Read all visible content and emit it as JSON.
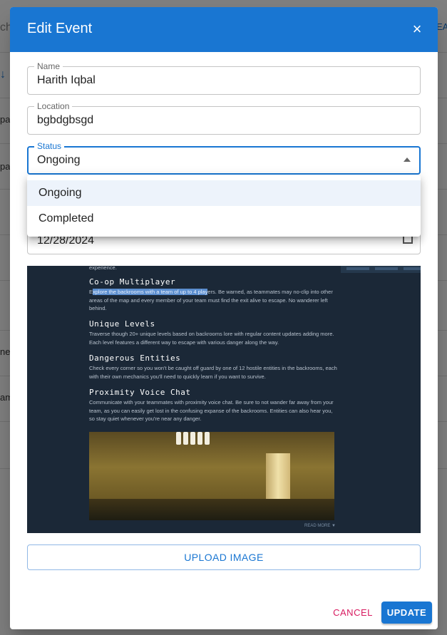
{
  "background": {
    "fragments": [
      "ch",
      "EA",
      "↓",
      "pa",
      "pa",
      "ne",
      "am"
    ]
  },
  "dialog": {
    "title": "Edit Event",
    "close_icon": "close-icon",
    "fields": {
      "name": {
        "label": "Name",
        "value": "Harith Iqbal"
      },
      "location": {
        "label": "Location",
        "value": "bgbdgbsgd"
      },
      "status": {
        "label": "Status",
        "value": "Ongoing"
      },
      "date": {
        "value": "12/28/2024"
      }
    },
    "status_menu": {
      "options": [
        "Ongoing",
        "Completed"
      ],
      "selected": "Ongoing"
    },
    "preview": {
      "intro_fragment": "experience.",
      "sections": [
        {
          "heading": "Co-op Multiplayer",
          "highlight_pre": "E",
          "highlight": "xplore the backrooms with a team of up to 4 play",
          "text": "ers. Be warned, as teammates may no-clip into other areas of the map and every member of your team must find the exit alive to escape. No wanderer left behind."
        },
        {
          "heading": "Unique Levels",
          "text": "Traverse though 20+ unique levels based on backrooms lore with regular content updates adding more. Each level features a different way to escape with various danger along the way."
        },
        {
          "heading": "Dangerous Entities",
          "text": "Check every corner so you won't be caught off guard by one of 12 hostile entities in the backrooms, each with their own mechanics you'll need to quickly learn if you want to survive."
        },
        {
          "heading": "Proximity Voice Chat",
          "text": "Communicate with your teammates with proximity voice chat. Be sure to not wander far away from your team, as you can easily get lost in the confusing expanse of the backrooms. Entities can also hear you, so stay quiet whenever you're near any danger."
        }
      ],
      "read_more": "READ MORE ▼"
    },
    "upload_label": "UPLOAD IMAGE",
    "cancel_label": "CANCEL",
    "update_label": "UPDATE"
  },
  "colors": {
    "primary": "#1976d2",
    "cancel": "#d81b60",
    "menu_selected": "#edf3fb",
    "preview_bg": "#1b2837"
  }
}
